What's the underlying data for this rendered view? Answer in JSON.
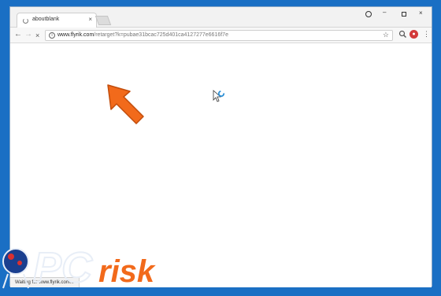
{
  "tab": {
    "title": "aboutblank",
    "close": "×"
  },
  "window": {
    "minimize": "–",
    "close": "×"
  },
  "toolbar": {
    "back": "←",
    "forward": "→",
    "stop": "×"
  },
  "address": {
    "host": "www.flyrik.com",
    "path": "/retarget?k=pubae31bcac725d401ca4127277e6616f7e",
    "info": "i",
    "star": "☆"
  },
  "status": {
    "text": "Waiting for www.flyrik.com..."
  },
  "watermark": {
    "brand": "PCrisk"
  },
  "colors": {
    "desktop": "#1a6fc4",
    "arrow": "#f26a1b",
    "spinner": "#2b8fd6"
  },
  "icons": [
    "loading-spinner-icon",
    "info-icon",
    "star-icon",
    "menu-icon",
    "arrow-icon",
    "cursor-icon"
  ]
}
